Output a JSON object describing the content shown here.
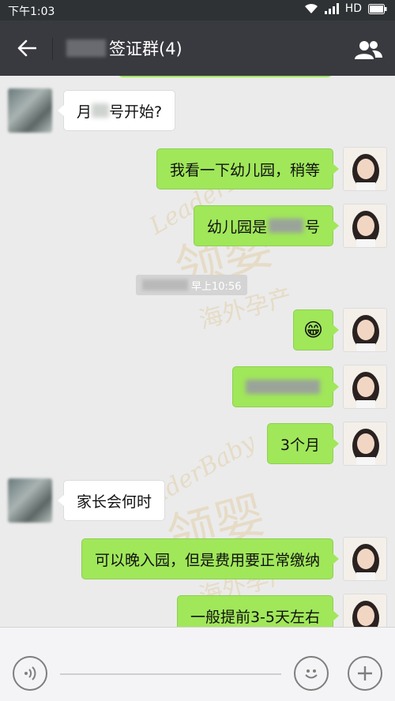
{
  "status_bar": {
    "time": "下午1:03",
    "network": "HD"
  },
  "title_bar": {
    "title": "签证群(4)"
  },
  "messages": [
    {
      "from": "them",
      "text_before": "月",
      "text_after": "号开始?"
    },
    {
      "from": "me",
      "text": "我看一下幼儿园，稍等"
    },
    {
      "from": "me",
      "text_before": "幼儿园是",
      "text_after": "号"
    },
    {
      "from": "me",
      "emoji": "😁"
    },
    {
      "from": "me",
      "text": ""
    },
    {
      "from": "me",
      "text": "3个月"
    },
    {
      "from": "them",
      "text": "家长会何时"
    },
    {
      "from": "me",
      "text": "可以晚入园，但是费用要正常缴纳"
    },
    {
      "from": "me",
      "text": "一般提前3-5天左右"
    }
  ],
  "timestamp": {
    "text": "早上10:56"
  },
  "watermark": {
    "latin": "LeaderBaby",
    "cn_main": "领婴",
    "cn_sub": "海外孕产"
  },
  "icons": [
    "back-arrow-icon",
    "group-members-icon",
    "voice-icon",
    "emoji-icon",
    "plus-icon",
    "wifi-icon",
    "signal-icon",
    "battery-icon"
  ],
  "colors": {
    "my_bubble": "#a0e75a",
    "their_bubble": "#ffffff",
    "title_bar": "#393a3f",
    "chat_bg": "#ebebeb"
  }
}
